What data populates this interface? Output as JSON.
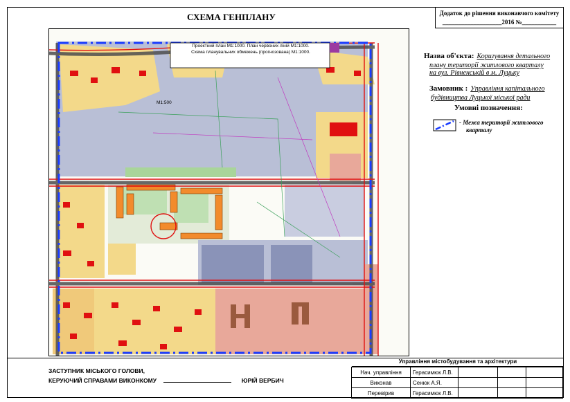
{
  "scheme_title": "СХЕМА ГЕНПЛАНУ",
  "stamp": {
    "line1": "Додаток до рішення виконавчого комітету",
    "line2": "___________________2016  №___________"
  },
  "map_caption": {
    "line1": "Проектний план  М1:1000. План червоних ліній   М1:1000.",
    "line2": "Схема планувальних обмежень  (прогнозована)  М1:1000."
  },
  "map_scale_label": "М1:500",
  "object": {
    "label": "Назва об'єкта:",
    "value_line1": "Коригування детального",
    "value_line2": "плану території житлового кварталу",
    "value_line3": "на вул. Рівненській в м. Луцьку"
  },
  "customer": {
    "label": "Замовник :",
    "value_line1": "Управління капітального",
    "value_line2": "будівництва  Луцької міської ради"
  },
  "legend": {
    "title": "Умовні позначення:",
    "item_line1": "Межа території житлового",
    "item_line2": "кварталу",
    "line_color": "#1a3cff"
  },
  "signature": {
    "line1": "ЗАСТУПНИК МІСЬКОГО ГОЛОВИ,",
    "line2": "КЕРУЮЧИЙ СПРАВАМИ ВИКОНКОМУ",
    "name": "ЮРІЙ ВЕРБИЧ"
  },
  "title_block": {
    "header": "Управління містобудування та архітектури",
    "rows": [
      {
        "role": "Нач. управління",
        "name": "Герасимюк Л.В."
      },
      {
        "role": "Виконав",
        "name": "Сенюк А.Я."
      },
      {
        "role": "Перевірив",
        "name": "Герасимюк Л.В."
      }
    ]
  },
  "colors": {
    "residential": "#f3d98a",
    "industrial": "#b9bfd6",
    "public": "#e8a89a",
    "road": "#4d4d4d",
    "red_line": "#e01010",
    "green": "#a9d59a",
    "boundary": "#1a3cff"
  }
}
